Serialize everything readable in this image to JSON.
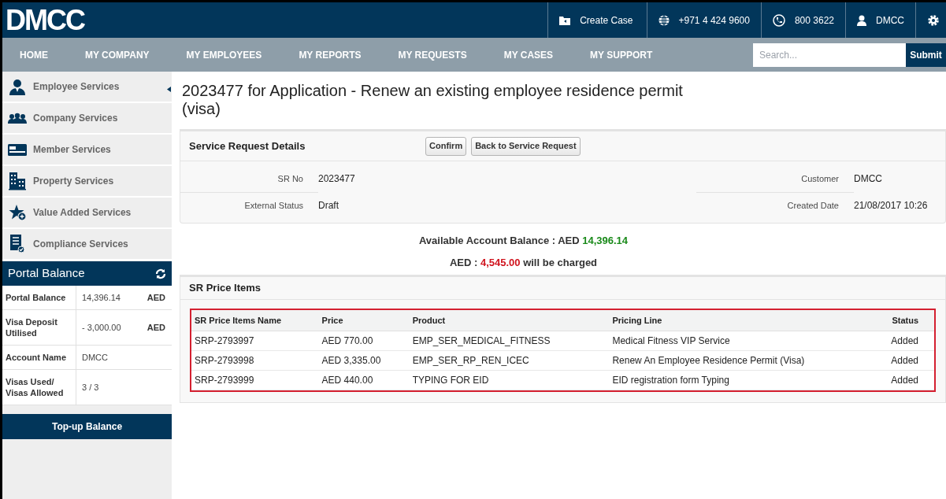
{
  "header": {
    "logo": "DMCC",
    "actions": [
      {
        "kind": "case",
        "label": "Create Case"
      },
      {
        "kind": "globe",
        "label": "+971 4 424 9600"
      },
      {
        "kind": "phone",
        "label": "800 3622"
      },
      {
        "kind": "user",
        "label": "DMCC"
      },
      {
        "kind": "gear"
      }
    ]
  },
  "nav": {
    "items": [
      "HOME",
      "MY COMPANY",
      "MY EMPLOYEES",
      "MY REPORTS",
      "MY REQUESTS",
      "MY CASES",
      "MY SUPPORT"
    ],
    "search": {
      "placeholder": "Search..."
    },
    "submit": "Submit"
  },
  "sidebar": {
    "items": [
      {
        "kind": "employee",
        "label": "Employee Services"
      },
      {
        "kind": "company",
        "label": "Company Services"
      },
      {
        "kind": "member",
        "label": "Member Services"
      },
      {
        "kind": "property",
        "label": "Property Services"
      },
      {
        "kind": "value",
        "label": "Value Added Services"
      },
      {
        "kind": "compliance",
        "label": "Compliance Services"
      }
    ],
    "balance": {
      "title": "Portal Balance",
      "rows": [
        {
          "label": "Portal Balance",
          "value": "14,396.14",
          "unit": "AED"
        },
        {
          "label": "Visa Deposit Utilised",
          "value": "- 3,000.00",
          "unit": "AED"
        },
        {
          "label": "Account Name",
          "value": "DMCC"
        },
        {
          "label": "Visas Used/ Visas Allowed",
          "value": "3 / 3"
        }
      ],
      "button": "Top-up Balance"
    }
  },
  "page_title": "2023477 for Application - Renew an existing employee residence permit (visa)",
  "details": {
    "title": "Service Request Details",
    "buttons": [
      "Confirm",
      "Back to Service Request"
    ],
    "fields": [
      {
        "label": "SR No",
        "value": "2023477"
      },
      {
        "label": "Customer",
        "value": "DMCC"
      },
      {
        "label": "External Status",
        "value": "Draft"
      },
      {
        "label": "Created Date",
        "value": "21/08/2017 10:26"
      }
    ]
  },
  "summary": {
    "balance_label": "Available Account Balance : AED",
    "balance_amount": "14,396.14",
    "charge_prefix": "AED :",
    "charge_amount": "4,545.00",
    "charge_suffix": "will be charged"
  },
  "price_items": {
    "title": "SR Price Items",
    "columns": [
      "SR Price Items Name",
      "Price",
      "Product",
      "Pricing Line",
      "Status"
    ],
    "rows": [
      [
        "SRP-2793997",
        "AED 770.00",
        "EMP_SER_MEDICAL_FITNESS",
        "Medical Fitness VIP Service",
        "Added"
      ],
      [
        "SRP-2793998",
        "AED 3,335.00",
        "EMP_SER_RP_REN_ICEC",
        "Renew An Employee Residence Permit (Visa)",
        "Added"
      ],
      [
        "SRP-2793999",
        "AED 440.00",
        "TYPING FOR EID",
        "EID registration form Typing",
        "Added"
      ]
    ]
  }
}
